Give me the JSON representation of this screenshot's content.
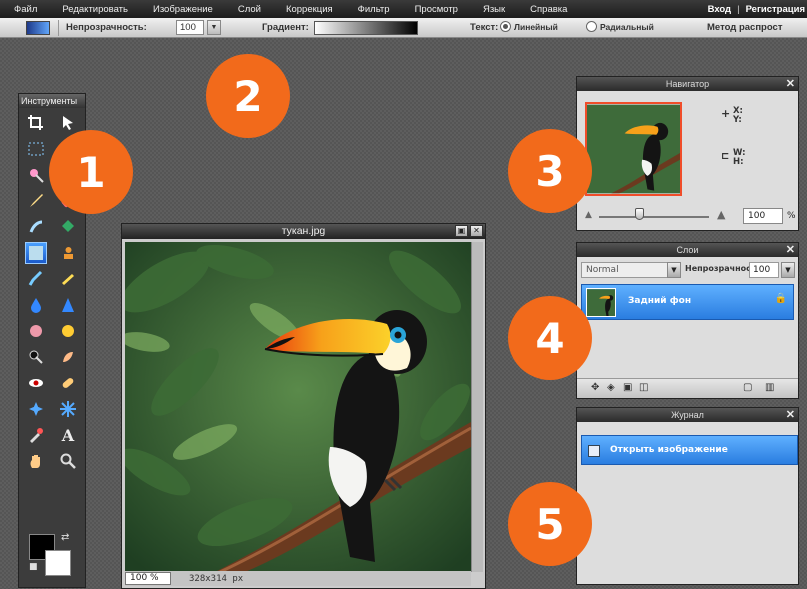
{
  "menu": {
    "items": [
      "Файл",
      "Редактировать",
      "Изображение",
      "Слой",
      "Коррекция",
      "Фильтр",
      "Просмотр",
      "Язык",
      "Справка"
    ],
    "login": "Вход",
    "separator": "|",
    "register": "Регистрация"
  },
  "options": {
    "opacity_label": "Непрозрачность:",
    "opacity_value": "100",
    "gradient_label": "Градиент:",
    "text_label": "Текст:",
    "linear_label": "Линейный",
    "radial_label": "Радиальный",
    "method_label": "Метод распрост"
  },
  "tools": {
    "title": "Инструменты"
  },
  "image_window": {
    "title": "тукан.jpg",
    "zoom": "100 %",
    "size": "328x314 px"
  },
  "navigator": {
    "title": "Навигатор",
    "x_label": "X:",
    "y_label": "Y:",
    "w_label": "W:",
    "h_label": "H:",
    "zoom": "100",
    "pct": "%"
  },
  "layers": {
    "title": "Слои",
    "blend_mode": "Normal",
    "opacity_label": "Непрозрачность:",
    "opacity_value": "100",
    "layer_name": "Задний фон"
  },
  "history": {
    "title": "Журнал",
    "item": "Открыть изображение"
  },
  "badges": [
    "1",
    "2",
    "3",
    "4",
    "5"
  ],
  "colors": {
    "badge": "#f26a1b",
    "selection": "#2a7de0",
    "foreground": "#000000",
    "background": "#ffffff"
  }
}
